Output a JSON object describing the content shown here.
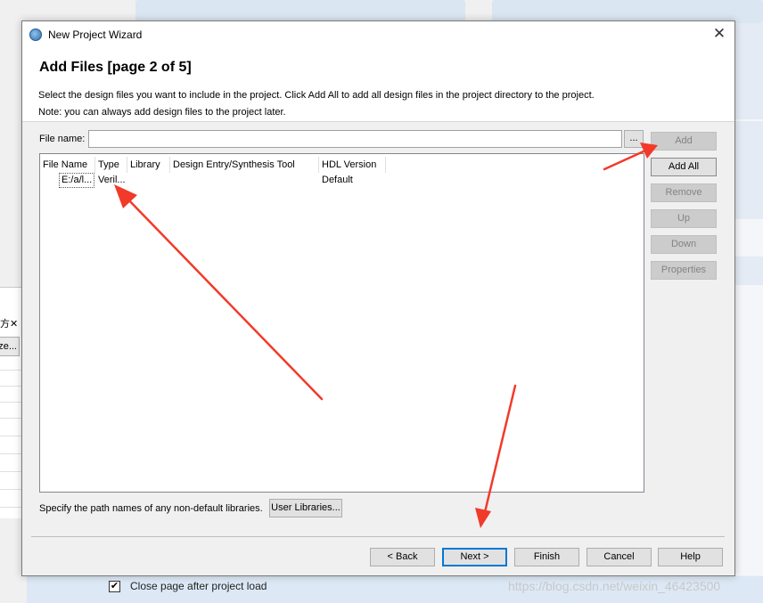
{
  "background": {
    "restore_glyph": "\u0001",
    "fragment_button": "ze...",
    "checkbox_label": "Close page after project load",
    "checkbox_mark": "✔",
    "watermark": "https://blog.csdn.net/weixin_46423500"
  },
  "dialog": {
    "title": "New Project Wizard",
    "heading": "Add Files [page 2 of 5]",
    "description_line1": "Select the design files you want to include in the project. Click Add All to add all design files in the project directory to the project.",
    "description_line2": "Note: you can always add design files to the project later.",
    "file_name_label": "File name:",
    "file_name_value": "",
    "browse_label": "...",
    "table": {
      "columns": [
        "File Name",
        "Type",
        "Library",
        "Design Entry/Synthesis Tool",
        "HDL Version"
      ],
      "rows": [
        {
          "file_name": "E:/a/l...",
          "type": "Veril...",
          "library": "",
          "tool": "",
          "hdl_version": "Default"
        }
      ]
    },
    "side_buttons": {
      "add": "Add",
      "add_all": "Add All",
      "remove": "Remove",
      "up": "Up",
      "down": "Down",
      "properties": "Properties"
    },
    "library_text": "Specify the path names of any non-default libraries.",
    "user_libraries": "User Libraries...",
    "nav_buttons": {
      "back": "< Back",
      "next": "Next >",
      "finish": "Finish",
      "cancel": "Cancel",
      "help": "Help"
    }
  },
  "colors": {
    "annotation_arrow": "#f23a2a",
    "default_button_border": "#0078d7"
  }
}
